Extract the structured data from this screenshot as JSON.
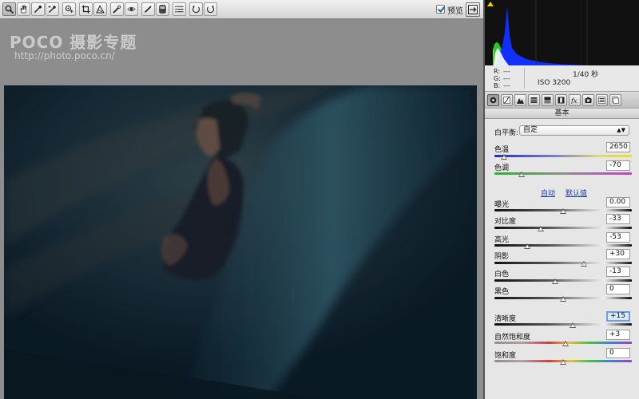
{
  "toolbar": {
    "tools": [
      "zoom-tool",
      "hand-tool",
      "white-balance-tool",
      "color-sampler-tool",
      "targeted-adjustment-tool",
      "crop-tool",
      "straighten-tool",
      "spot-removal-tool",
      "red-eye-removal-tool",
      "adjustment-brush-tool",
      "graduated-filter-tool",
      "preferences-tool",
      "rotate-left-tool",
      "rotate-right-tool"
    ],
    "preview_label": "预览",
    "preview_checked": true
  },
  "watermark": {
    "brand": "POCO 摄影专题",
    "url": "http://photo.poco.cn/"
  },
  "info": {
    "r_label": "R:",
    "g_label": "G:",
    "b_label": "B:",
    "r_value": "---",
    "g_value": "---",
    "b_value": "---",
    "shutter": "1/40 秒",
    "iso": "ISO 3200"
  },
  "panel_tabs": [
    "basic-tab-icon",
    "tone-curve-tab-icon",
    "detail-tab-icon",
    "hsl-tab-icon",
    "split-toning-tab-icon",
    "lens-corrections-tab-icon",
    "effects-tab-icon",
    "camera-calibration-tab-icon",
    "presets-tab-icon",
    "snapshots-tab-icon"
  ],
  "section_title": "基本",
  "white_balance": {
    "label": "白平衡:",
    "value": "自定"
  },
  "links": {
    "auto": "自动",
    "default": "默认值"
  },
  "sliders": {
    "temperature": {
      "label": "色温",
      "value": "2650",
      "fraction": 0.07
    },
    "tint": {
      "label": "色调",
      "value": "-70",
      "fraction": 0.2
    },
    "exposure": {
      "label": "曝光",
      "value": "0.00",
      "fraction": 0.5
    },
    "contrast": {
      "label": "对比度",
      "value": "-33",
      "fraction": 0.34
    },
    "highlights": {
      "label": "高光",
      "value": "-53",
      "fraction": 0.24
    },
    "shadows": {
      "label": "阴影",
      "value": "+30",
      "fraction": 0.65
    },
    "whites": {
      "label": "白色",
      "value": "-13",
      "fraction": 0.44
    },
    "blacks": {
      "label": "黑色",
      "value": "0",
      "fraction": 0.5
    },
    "clarity": {
      "label": "清晰度",
      "value": "+15",
      "fraction": 0.57
    },
    "vibrance": {
      "label": "自然饱和度",
      "value": "+3",
      "fraction": 0.52
    },
    "saturation": {
      "label": "饱和度",
      "value": "0",
      "fraction": 0.5
    }
  }
}
